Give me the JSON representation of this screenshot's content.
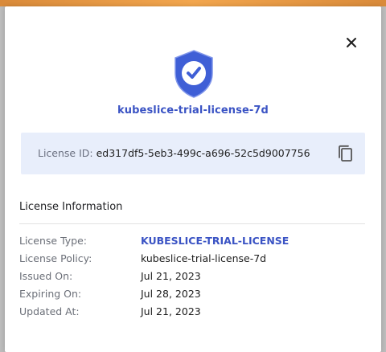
{
  "dialog": {
    "close_icon": "close-icon",
    "badge_icon": "shield-check-icon",
    "license_name": "kubeslice-trial-license-7d",
    "license_id_label": "License ID:",
    "license_id_value": "ed317df5-5eb3-499c-a696-52c5d9007756",
    "copy_icon": "copy-icon",
    "section_title": "License Information",
    "rows": [
      {
        "label": "License Type:",
        "value": "KUBESLICE-TRIAL-LICENSE"
      },
      {
        "label": "License Policy:",
        "value": "kubeslice-trial-license-7d"
      },
      {
        "label": "Issued On:",
        "value": "Jul 21, 2023"
      },
      {
        "label": "Expiring On:",
        "value": "Jul 28, 2023"
      },
      {
        "label": "Updated At:",
        "value": "Jul 21, 2023"
      }
    ]
  },
  "colors": {
    "accent": "#3a53c4",
    "shield": "#3f5fd6",
    "id_box_bg": "#e8eefb",
    "top_bar": "#f2a64e"
  }
}
